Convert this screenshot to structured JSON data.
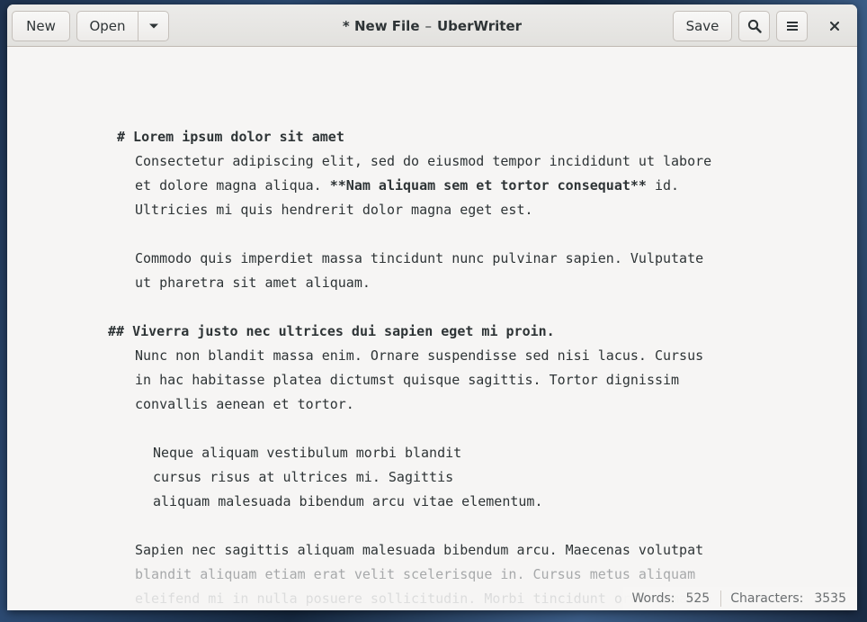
{
  "header": {
    "new_label": "New",
    "open_label": "Open",
    "save_label": "Save",
    "title_modified": "* New File",
    "title_sep": "–",
    "title_app": "UberWriter",
    "icons": {
      "dropdown": "chevron-down-icon",
      "search": "search-icon",
      "menu": "hamburger-menu-icon",
      "close": "close-icon"
    }
  },
  "editor": {
    "lines": [
      {
        "text": "# Lorem ipsum dolor sit amet",
        "style": "heading"
      },
      {
        "text": "Consectetur adipiscing elit, sed do eiusmod tempor incididunt ut labore",
        "style": "body"
      },
      {
        "text": "et dolore magna aliqua. ",
        "bold": "**Nam aliquam sem et tortor consequat**",
        "after": " id.",
        "style": "mixed"
      },
      {
        "text": "Ultricies mi quis hendrerit dolor magna eget est.",
        "style": "body"
      },
      {
        "text": "Commodo quis imperdiet massa tincidunt nunc pulvinar sapien. Vulputate",
        "style": "body"
      },
      {
        "text": "ut pharetra sit amet aliquam.",
        "style": "body"
      },
      {
        "text": "## Viverra justo nec ultrices dui sapien eget mi proin.",
        "style": "heading"
      },
      {
        "text": "Nunc non blandit massa enim. Ornare suspendisse sed nisi lacus. Cursus",
        "style": "body"
      },
      {
        "text": "in hac habitasse platea dictumst quisque sagittis. Tortor dignissim",
        "style": "body"
      },
      {
        "text": "convallis aenean et tortor.",
        "style": "body"
      },
      {
        "text": "Neque aliquam vestibulum morbi blandit",
        "style": "quote"
      },
      {
        "text": "cursus risus at ultrices mi. Sagittis",
        "style": "quote"
      },
      {
        "text": "aliquam malesuada bibendum arcu vitae elementum.",
        "style": "quote"
      },
      {
        "text": "Sapien nec sagittis aliquam malesuada bibendum arcu. Maecenas volutpat",
        "style": "body"
      },
      {
        "text": "blandit aliquam etiam erat velit scelerisque in. Cursus metus aliquam",
        "style": "faded"
      },
      {
        "text": "eleifend mi in nulla posuere sollicitudin. Morbi tincidunt ornare massa",
        "style": "ghost"
      }
    ]
  },
  "status": {
    "words_label": "Words:",
    "words_value": "525",
    "chars_label": "Characters:",
    "chars_value": "3535"
  }
}
